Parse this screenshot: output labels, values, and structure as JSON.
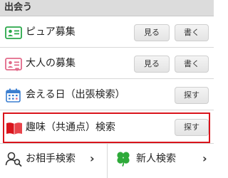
{
  "section": {
    "title": "出会う"
  },
  "rows": [
    {
      "label": "ピュア募集",
      "icon": "profile-card-icon",
      "see": "見る",
      "write": "書く"
    },
    {
      "label": "大人の募集",
      "icon": "profile-card-heart-icon",
      "see": "見る",
      "write": "書く"
    },
    {
      "label": "会える日（出張検索）",
      "icon": "calendar-icon",
      "search": "探す"
    },
    {
      "label": "趣味（共通点）検索",
      "icon": "open-book-icon",
      "search": "探す"
    }
  ],
  "bottom_nav": [
    {
      "label": "お相手検索",
      "icon": "person-search-icon"
    },
    {
      "label": "新人検索",
      "icon": "four-leaf-clover-icon"
    }
  ],
  "colors": {
    "highlight": "#d9141c",
    "icon_green": "#2aa84a",
    "icon_pink": "#e26a8a",
    "icon_blue": "#3b7fd0",
    "book_red": "#d9141c",
    "clover_green": "#2eaa3a"
  }
}
